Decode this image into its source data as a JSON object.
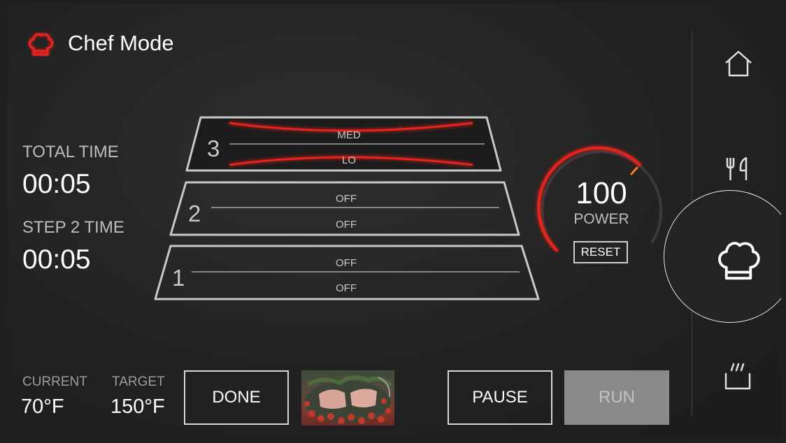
{
  "header": {
    "title": "Chef Mode",
    "icon": "chef-hat-icon",
    "icon_color": "#e0201a"
  },
  "times": {
    "total_label": "TOTAL TIME",
    "total_value": "00:05",
    "step_label": "STEP 2 TIME",
    "step_value": "00:05"
  },
  "racks": [
    {
      "number": "3",
      "top_label": "MED",
      "bottom_label": "LO",
      "active": true
    },
    {
      "number": "2",
      "top_label": "OFF",
      "bottom_label": "OFF",
      "active": false
    },
    {
      "number": "1",
      "top_label": "OFF",
      "bottom_label": "OFF",
      "active": false
    }
  ],
  "power": {
    "value": "100",
    "label": "POWER",
    "reset_label": "RESET",
    "level_percent": 100,
    "accent": "#e8241c"
  },
  "temperature": {
    "current_label": "CURRENT",
    "current_value": "70°F",
    "target_label": "TARGET",
    "target_value": "150°F"
  },
  "buttons": {
    "done": "DONE",
    "pause": "PAUSE",
    "run": "RUN"
  },
  "nav": {
    "items": [
      {
        "name": "home",
        "icon": "home-icon"
      },
      {
        "name": "utensils",
        "icon": "utensils-icon"
      },
      {
        "name": "chef-mode",
        "icon": "chef-hat-icon",
        "active": true
      },
      {
        "name": "steam",
        "icon": "steam-pot-icon"
      }
    ]
  },
  "colors": {
    "accent": "#e8241c",
    "text": "#ffffff",
    "muted": "#bdbdbd"
  }
}
